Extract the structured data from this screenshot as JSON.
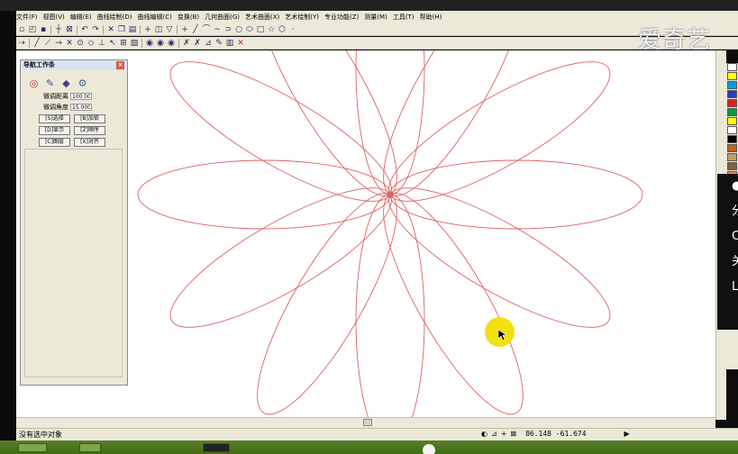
{
  "menu": [
    "文件(F)",
    "视图(V)",
    "编辑(E)",
    "曲线绘制(D)",
    "曲线编辑(C)",
    "变换(B)",
    "几何曲面(G)",
    "艺术曲面(X)",
    "艺术绘制(Y)",
    "专业功能(Z)",
    "测量(M)",
    "工具(T)",
    "帮助(H)"
  ],
  "toolbar1": {
    "icons": [
      "new-icon",
      "open-icon",
      "save-icon",
      "select-icon",
      "window-select-icon",
      "undo-icon",
      "redo-icon",
      "cut-icon",
      "copy-icon",
      "paste-icon",
      "crosshair-icon",
      "layer-icon",
      "filter-icon",
      "point-icon",
      "line-icon",
      "arc-icon",
      "spline-icon",
      "polyline-icon",
      "circle-icon",
      "rect-icon",
      "star-icon",
      "polygon-icon",
      "dot-icon"
    ]
  },
  "toolbar2": {
    "icons": [
      "snap-endpoint-icon",
      "snap-line-icon",
      "snap-mid-icon",
      "snap-intersect-icon",
      "snap-center-icon",
      "snap-quad-icon",
      "snap-perp-icon",
      "snap-tangent-icon",
      "snap-grid-icon",
      "snap-near-icon",
      "render-icon",
      "render-wire-icon",
      "render-shade-icon",
      "cancel-snap-icon",
      "delete-icon"
    ]
  },
  "watermark": "爱奇艺",
  "nav_panel": {
    "title": "导航工作条",
    "fields": [
      {
        "label": "微调距离",
        "value": "100.00"
      },
      {
        "label": "微调角度",
        "value": "15.000"
      }
    ],
    "buttons": [
      [
        "[S]选择",
        "[B]加锁"
      ],
      [
        "[D]显示",
        "[Z]顺序"
      ],
      [
        "[C]图层",
        "[X]对齐"
      ]
    ]
  },
  "dark_panel": [
    "●",
    "分",
    "C",
    "关",
    "L"
  ],
  "status": {
    "text": "没有选中对象",
    "coords": "86.148  -61.674"
  },
  "drawing": {
    "petal_count": 12,
    "angle_step_deg": 30,
    "stroke": "#e06060"
  },
  "palette": [
    "#ffffff",
    "#ffff00",
    "#00a0e0",
    "#2040c0",
    "#e02020",
    "#00a040",
    "#ffff00",
    "#ffffff",
    "#000000",
    "#c06020",
    "#c0a060",
    "#806040",
    "#ff8040",
    "#00c0c0",
    "#ffffff",
    "#804000",
    "#c0c0c0",
    "#000000",
    "#a0a0a0",
    "#606060",
    "#c08040",
    "#000000",
    "#804020",
    "#ffffff",
    "#c06000",
    "#000000",
    "#c00000",
    "#808080"
  ]
}
